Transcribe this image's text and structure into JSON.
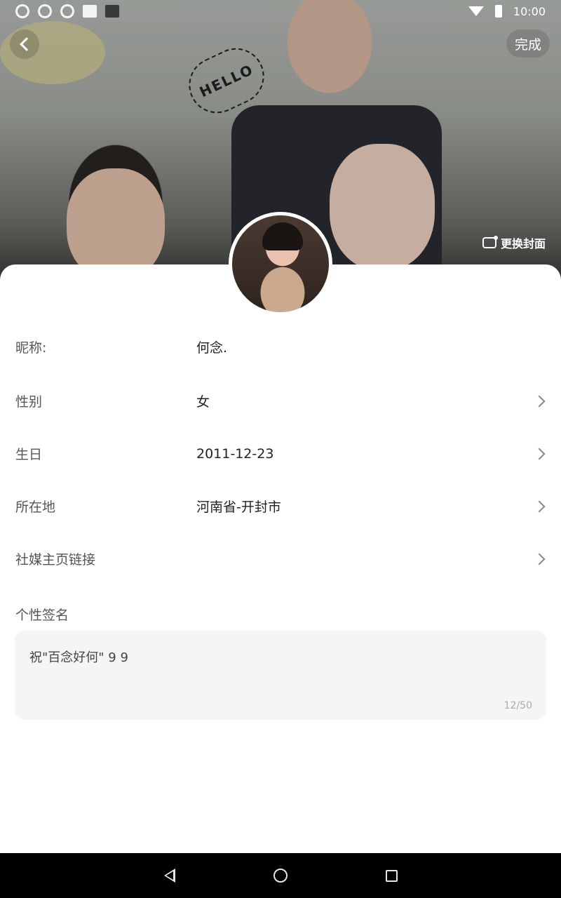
{
  "status_bar": {
    "time": "10:00"
  },
  "header": {
    "done_label": "完成",
    "change_cover_label": "更换封面"
  },
  "cover_art": {
    "hello_text": "HELLO"
  },
  "fields": [
    {
      "label": "昵称:",
      "value": "何念.",
      "has_chevron": false
    },
    {
      "label": "性别",
      "value": "女",
      "has_chevron": true
    },
    {
      "label": "生日",
      "value": "2011-12-23",
      "has_chevron": true
    },
    {
      "label": "所在地",
      "value": "河南省-开封市",
      "has_chevron": true
    },
    {
      "label": "社媒主页链接",
      "value": "",
      "has_chevron": true
    }
  ],
  "signature": {
    "label": "个性签名",
    "text": "祝\"百念好何\" 9 9",
    "counter": "12/50"
  },
  "colors": {
    "accent_bg": "#f5f4f7",
    "nav_bar": "#000000"
  }
}
